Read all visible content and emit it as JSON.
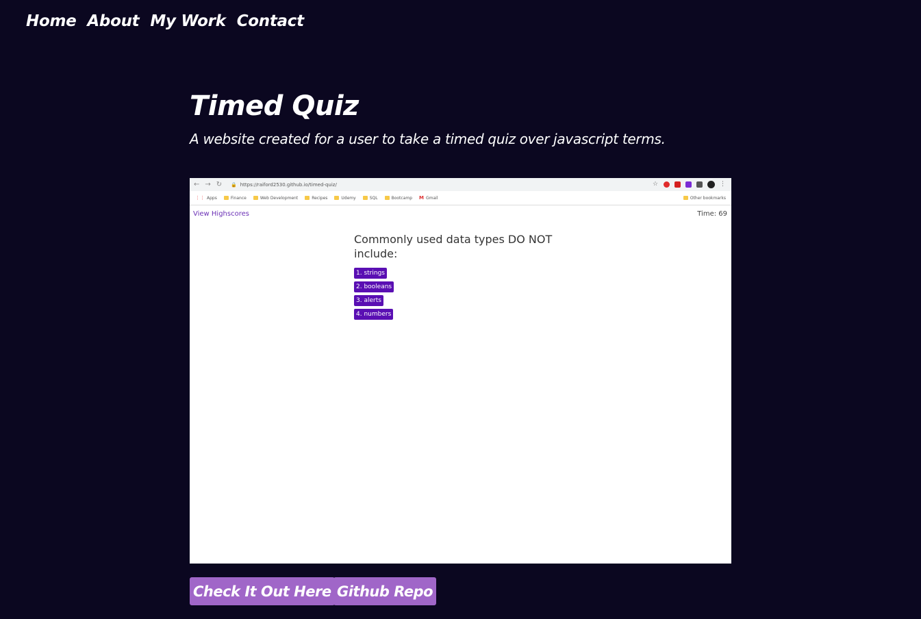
{
  "nav": {
    "home": "Home",
    "about": "About",
    "my_work": "My Work",
    "contact": "Contact"
  },
  "project": {
    "title": "Timed Quiz",
    "description": "A website created for a user to take a timed quiz over javascript terms."
  },
  "screenshot": {
    "url": "https://raiford2530.github.io/timed-quiz/",
    "bookmarks": [
      "Apps",
      "Finance",
      "Web Development",
      "Recipes",
      "Udemy",
      "SQL",
      "Bootcamp",
      "Gmail"
    ],
    "other_bookmarks": "Other bookmarks",
    "view_highscores": "View Highscores",
    "timer": "Time: 69",
    "question": "Commonly used data types DO NOT include:",
    "answers": [
      "1. strings",
      "2. booleans",
      "3. alerts",
      "4. numbers"
    ]
  },
  "buttons": {
    "live": "Check It Out Here",
    "repo": "Github Repo"
  },
  "colors": {
    "background": "#0b0720",
    "button": "#a066c8",
    "answer": "#5a0fb3"
  }
}
